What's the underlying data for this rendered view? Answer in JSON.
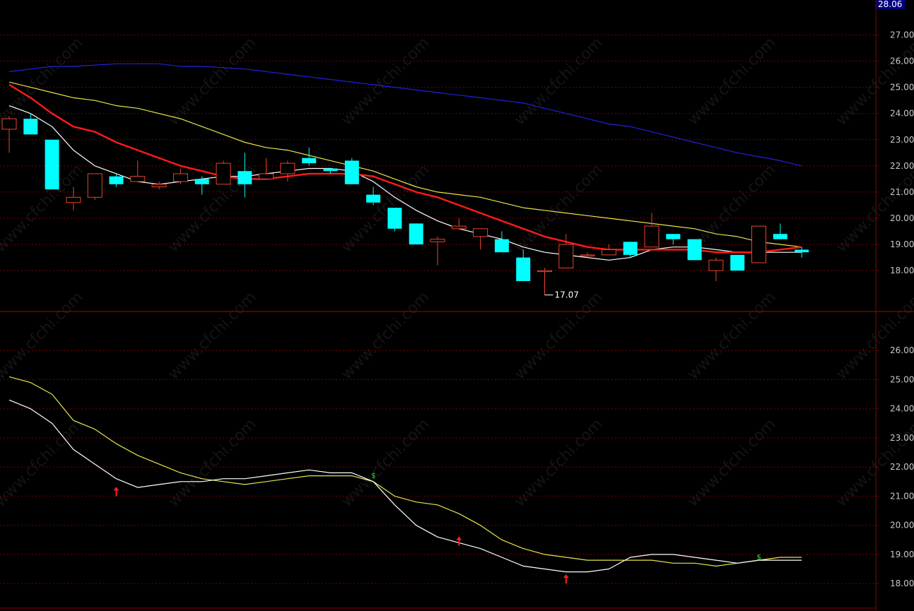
{
  "watermark": "www.cfchi.com",
  "colors": {
    "background": "#000000",
    "frame": "#8b0000",
    "grid": "#7a0000",
    "up": "#e8452c",
    "down": "#00ffff",
    "ma_white": "#ffffff",
    "ma_red": "#ff1a1a",
    "ma_yellow": "#e6e64a",
    "ma_blue": "#2222dd",
    "arrow": "#ff2020",
    "cross": "#20ff20"
  },
  "chart_data": [
    {
      "type": "candlestick",
      "title": "",
      "ylim": [
        16.6,
        28.2
      ],
      "yticks": [
        "18.00",
        "19.00",
        "20.00",
        "21.00",
        "22.00",
        "23.00",
        "24.00",
        "25.00",
        "26.00",
        "27.00"
      ],
      "last_price": "28.06",
      "low_label": "17.07",
      "candles": [
        {
          "o": 23.4,
          "h": 23.9,
          "l": 22.5,
          "c": 23.8
        },
        {
          "o": 23.8,
          "h": 24.0,
          "l": 23.2,
          "c": 23.2
        },
        {
          "o": 23.0,
          "h": 23.0,
          "l": 21.1,
          "c": 21.1
        },
        {
          "o": 20.6,
          "h": 21.2,
          "l": 20.3,
          "c": 20.8
        },
        {
          "o": 20.8,
          "h": 21.7,
          "l": 20.7,
          "c": 21.7
        },
        {
          "o": 21.6,
          "h": 21.7,
          "l": 21.2,
          "c": 21.3
        },
        {
          "o": 21.4,
          "h": 22.2,
          "l": 21.4,
          "c": 21.6
        },
        {
          "o": 21.2,
          "h": 21.4,
          "l": 21.1,
          "c": 21.3
        },
        {
          "o": 21.4,
          "h": 21.9,
          "l": 21.3,
          "c": 21.7
        },
        {
          "o": 21.5,
          "h": 21.6,
          "l": 20.9,
          "c": 21.3
        },
        {
          "o": 21.3,
          "h": 22.2,
          "l": 21.3,
          "c": 22.1
        },
        {
          "o": 21.8,
          "h": 22.5,
          "l": 20.8,
          "c": 21.3
        },
        {
          "o": 21.5,
          "h": 22.3,
          "l": 21.5,
          "c": 21.7
        },
        {
          "o": 21.7,
          "h": 22.2,
          "l": 21.4,
          "c": 22.1
        },
        {
          "o": 22.3,
          "h": 22.7,
          "l": 22.0,
          "c": 22.1
        },
        {
          "o": 21.9,
          "h": 21.9,
          "l": 21.7,
          "c": 21.8
        },
        {
          "o": 22.2,
          "h": 22.3,
          "l": 21.3,
          "c": 21.3
        },
        {
          "o": 20.9,
          "h": 21.2,
          "l": 20.5,
          "c": 20.6
        },
        {
          "o": 20.4,
          "h": 20.4,
          "l": 19.5,
          "c": 19.6
        },
        {
          "o": 19.8,
          "h": 19.8,
          "l": 19.0,
          "c": 19.0
        },
        {
          "o": 19.1,
          "h": 19.3,
          "l": 18.2,
          "c": 19.2
        },
        {
          "o": 19.6,
          "h": 20.0,
          "l": 19.6,
          "c": 19.7
        },
        {
          "o": 19.3,
          "h": 19.6,
          "l": 18.8,
          "c": 19.6
        },
        {
          "o": 19.2,
          "h": 19.5,
          "l": 18.7,
          "c": 18.7
        },
        {
          "o": 18.5,
          "h": 18.8,
          "l": 17.6,
          "c": 17.6
        },
        {
          "o": 18.0,
          "h": 18.1,
          "l": 17.07,
          "c": 18.0
        },
        {
          "o": 18.1,
          "h": 19.4,
          "l": 18.1,
          "c": 19.0
        },
        {
          "o": 18.6,
          "h": 18.7,
          "l": 18.5,
          "c": 18.6
        },
        {
          "o": 18.6,
          "h": 19.0,
          "l": 18.6,
          "c": 18.8
        },
        {
          "o": 19.1,
          "h": 19.1,
          "l": 18.5,
          "c": 18.6
        },
        {
          "o": 18.9,
          "h": 20.2,
          "l": 18.9,
          "c": 19.7
        },
        {
          "o": 19.4,
          "h": 19.4,
          "l": 19.0,
          "c": 19.2
        },
        {
          "o": 19.2,
          "h": 19.2,
          "l": 18.4,
          "c": 18.4
        },
        {
          "o": 18.0,
          "h": 18.5,
          "l": 17.6,
          "c": 18.4
        },
        {
          "o": 18.6,
          "h": 18.6,
          "l": 18.0,
          "c": 18.0
        },
        {
          "o": 18.3,
          "h": 19.7,
          "l": 18.3,
          "c": 19.7
        },
        {
          "o": 19.4,
          "h": 19.8,
          "l": 19.2,
          "c": 19.2
        },
        {
          "o": 18.8,
          "h": 18.9,
          "l": 18.5,
          "c": 18.7
        }
      ],
      "series": [
        {
          "color_key": "ma_white",
          "width": 1.2,
          "values": [
            24.3,
            24.0,
            23.5,
            22.6,
            22.0,
            21.7,
            21.4,
            21.3,
            21.4,
            21.5,
            21.6,
            21.6,
            21.7,
            21.8,
            21.9,
            21.9,
            21.8,
            21.4,
            20.8,
            20.3,
            19.9,
            19.6,
            19.4,
            19.2,
            18.9,
            18.7,
            18.6,
            18.5,
            18.4,
            18.5,
            18.8,
            18.9,
            18.9,
            18.8,
            18.7,
            18.7,
            18.7,
            18.7
          ]
        },
        {
          "color_key": "ma_red",
          "width": 2.4,
          "values": [
            25.1,
            24.6,
            24.0,
            23.5,
            23.3,
            22.9,
            22.6,
            22.3,
            22.0,
            21.8,
            21.6,
            21.5,
            21.5,
            21.6,
            21.7,
            21.7,
            21.7,
            21.6,
            21.3,
            21.0,
            20.8,
            20.5,
            20.2,
            19.9,
            19.6,
            19.3,
            19.1,
            18.9,
            18.8,
            18.8,
            18.8,
            18.8,
            18.8,
            18.7,
            18.7,
            18.7,
            18.8,
            18.9
          ]
        },
        {
          "color_key": "ma_yellow",
          "width": 1.2,
          "values": [
            25.2,
            25.0,
            24.8,
            24.6,
            24.5,
            24.3,
            24.2,
            24.0,
            23.8,
            23.5,
            23.2,
            22.9,
            22.7,
            22.6,
            22.4,
            22.2,
            22.0,
            21.8,
            21.5,
            21.2,
            21.0,
            20.9,
            20.8,
            20.6,
            20.4,
            20.3,
            20.2,
            20.1,
            20.0,
            19.9,
            19.8,
            19.7,
            19.6,
            19.4,
            19.3,
            19.1,
            19.0,
            18.9
          ]
        },
        {
          "color_key": "ma_blue",
          "width": 1.2,
          "values": [
            25.6,
            25.7,
            25.8,
            25.8,
            25.85,
            25.9,
            25.9,
            25.9,
            25.8,
            25.8,
            25.75,
            25.7,
            25.6,
            25.5,
            25.4,
            25.3,
            25.2,
            25.1,
            25.0,
            24.9,
            24.8,
            24.7,
            24.6,
            24.5,
            24.4,
            24.2,
            24.0,
            23.8,
            23.6,
            23.5,
            23.3,
            23.1,
            22.9,
            22.7,
            22.5,
            22.35,
            22.2,
            22.0
          ]
        }
      ]
    },
    {
      "type": "line",
      "title": "",
      "ylim": [
        17.3,
        27.0
      ],
      "yticks": [
        "18.00",
        "19.00",
        "20.00",
        "21.00",
        "22.00",
        "23.00",
        "24.00",
        "25.00",
        "26.00"
      ],
      "series": [
        {
          "color_key": "ma_white",
          "width": 1.2,
          "values": [
            24.3,
            24.0,
            23.5,
            22.6,
            22.1,
            21.6,
            21.3,
            21.4,
            21.5,
            21.5,
            21.6,
            21.6,
            21.7,
            21.8,
            21.9,
            21.8,
            21.8,
            21.5,
            20.7,
            20.0,
            19.6,
            19.4,
            19.2,
            18.9,
            18.6,
            18.5,
            18.4,
            18.4,
            18.5,
            18.9,
            19.0,
            19.0,
            18.9,
            18.8,
            18.7,
            18.8,
            18.8,
            18.8
          ]
        },
        {
          "color_key": "ma_yellow",
          "width": 1.2,
          "values": [
            25.1,
            24.9,
            24.5,
            23.6,
            23.3,
            22.8,
            22.4,
            22.1,
            21.8,
            21.6,
            21.5,
            21.4,
            21.5,
            21.6,
            21.7,
            21.7,
            21.7,
            21.5,
            21.0,
            20.8,
            20.7,
            20.4,
            20.0,
            19.5,
            19.2,
            19.0,
            18.9,
            18.8,
            18.8,
            18.8,
            18.8,
            18.7,
            18.7,
            18.6,
            18.7,
            18.8,
            18.9,
            18.9
          ]
        }
      ],
      "up_arrows": [
        {
          "x": 5,
          "y": 21.0
        },
        {
          "x": 21,
          "y": 19.3
        },
        {
          "x": 26,
          "y": 18.0
        }
      ],
      "cross_marks": [
        {
          "x": 17,
          "y": 21.7
        },
        {
          "x": 35,
          "y": 18.9
        }
      ]
    }
  ]
}
